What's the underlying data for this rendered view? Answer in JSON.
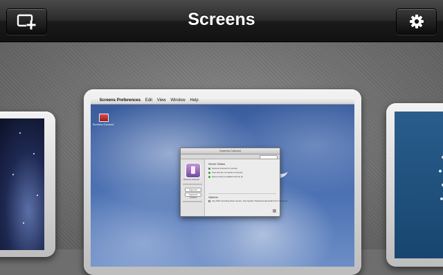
{
  "header": {
    "title": "Screens",
    "add_button_icon": "add-screen-icon",
    "settings_button_icon": "gear-icon"
  },
  "main_screen": {
    "menubar": {
      "app_name": "Screens Preferences",
      "menus": [
        "Edit",
        "View",
        "Window",
        "Help"
      ]
    },
    "desktop_icon_label": "Screens Connect",
    "prefs_window": {
      "title": "Screens Connect",
      "app_name": "Screens Connect",
      "sign_out": "Sign Out",
      "check_updates": "Check for Updates",
      "section_title": "Server Status",
      "status_rows": [
        "Screens Connect is running",
        "Uses Secure connection correctly",
        "Server Host is enabled and set up"
      ],
      "options_title": "Options",
      "option_row": "Use SSH tunneling when secure, Use System Password (keychain) from Sleeping"
    }
  },
  "colors": {
    "header_text": "#ffffff",
    "desktop_blue": "#4f74b5"
  }
}
